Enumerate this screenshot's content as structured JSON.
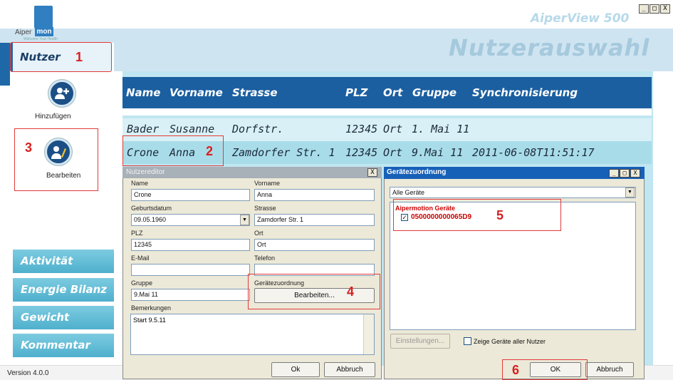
{
  "app": {
    "logo_text_a": "Aiper",
    "logo_text_b": "mon",
    "logo_tagline": "Welcome Your Health",
    "title": "AiperView 500",
    "window_buttons": [
      "_",
      "□",
      "X"
    ]
  },
  "header": {
    "page_title": "Nutzerauswahl"
  },
  "sidebar": {
    "active_item": "Nutzer",
    "add_label": "Hinzufügen",
    "edit_label": "Bearbeiten",
    "nav": [
      "Aktivität",
      "Energie Bilanz",
      "Gewicht",
      "Kommentar"
    ],
    "version": "Version 4.0.0"
  },
  "table": {
    "columns": [
      "Name",
      "Vorname",
      "Strasse",
      "PLZ",
      "Ort",
      "Gruppe",
      "Synchronisierung"
    ],
    "rows": [
      [
        "Bader",
        "Susanne",
        "Dorfstr.",
        "12345",
        "Ort",
        "1. Mai 11",
        ""
      ],
      [
        "Crone",
        "Anna",
        "Zamdorfer Str. 1",
        "12345",
        "Ort",
        "9.Mai 11",
        "2011-06-08T11:51:17"
      ]
    ]
  },
  "editor": {
    "title": "Nutzereditor",
    "close": "X",
    "labels": {
      "name": "Name",
      "vorname": "Vorname",
      "geburtsdatum": "Geburtsdatum",
      "strasse": "Strasse",
      "plz": "PLZ",
      "ort": "Ort",
      "email": "E-Mail",
      "telefon": "Telefon",
      "gruppe": "Gruppe",
      "geraete": "Gerätezuordnung",
      "bemerkungen": "Bemerkungen"
    },
    "values": {
      "name": "Crone",
      "vorname": "Anna",
      "geburtsdatum": "09.05.1960",
      "strasse": "Zamdorfer Str. 1",
      "plz": "12345",
      "ort": "Ort",
      "email": "",
      "telefon": "",
      "gruppe": "9.Mai 11",
      "bemerkungen": "Start 9.5.11"
    },
    "edit_button": "Bearbeiten...",
    "ok": "Ok",
    "cancel": "Abbruch"
  },
  "devices": {
    "title": "Gerätezuordnung",
    "filter": "Alle Geräte",
    "group": "Aipermotion Geräte",
    "device_id": "0500000000065D9",
    "device_checked": true,
    "settings_button": "Einstellungen...",
    "show_all_label": "Zeige Geräte aller Nutzer",
    "ok": "OK",
    "cancel": "Abbruch"
  },
  "annotations": [
    "1",
    "2",
    "3",
    "4",
    "5",
    "6"
  ],
  "colors": {
    "header_blue": "#1b5fa0",
    "row_highlight": "#a9dce9",
    "nav_button": "#5bb8d2",
    "annotation_red": "#d8201f"
  }
}
